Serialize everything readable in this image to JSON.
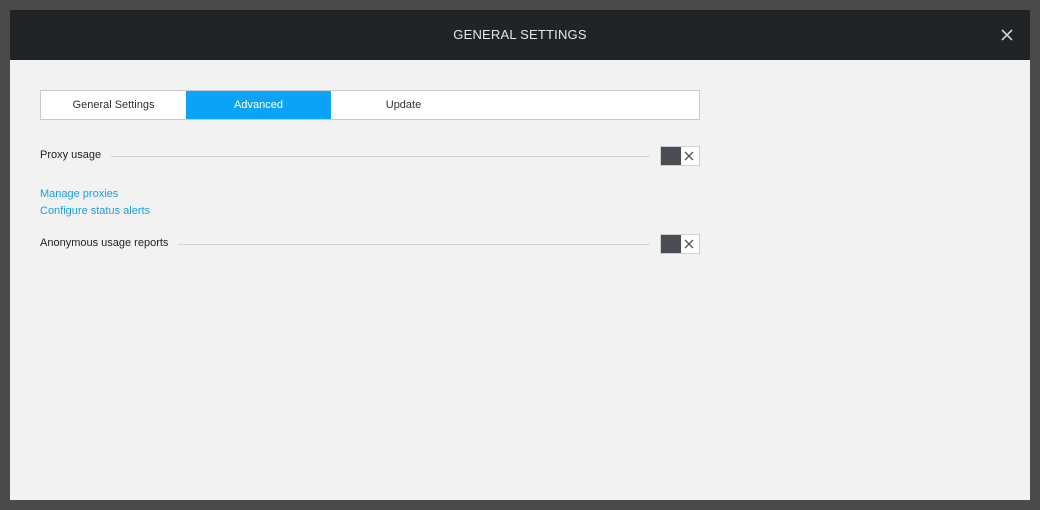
{
  "dialog": {
    "title": "GENERAL SETTINGS",
    "close_icon": "close-icon"
  },
  "tabs": [
    {
      "label": "General Settings",
      "active": false
    },
    {
      "label": "Advanced",
      "active": true
    },
    {
      "label": "Update",
      "active": false
    }
  ],
  "settings": {
    "proxy": {
      "label": "Proxy usage",
      "enabled": false
    },
    "anonymous": {
      "label": "Anonymous usage reports",
      "enabled": false
    }
  },
  "links": {
    "manage_proxies": "Manage proxies",
    "configure_alerts": "Configure status alerts"
  },
  "colors": {
    "accent": "#0ba3f5",
    "link": "#1a9ee0",
    "titlebar": "#212427",
    "toggle_knob": "#474d53"
  }
}
